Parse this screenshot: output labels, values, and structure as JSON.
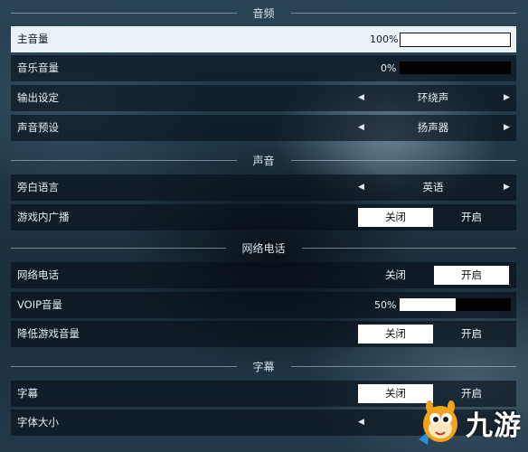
{
  "sections": {
    "audio": "音频",
    "voice": "声音",
    "voip": "网络电话",
    "subtitles": "字幕"
  },
  "rows": {
    "master_volume": {
      "label": "主音量",
      "percent_text": "100%",
      "value_percent": 100
    },
    "music_volume": {
      "label": "音乐音量",
      "percent_text": "0%",
      "value_percent": 0
    },
    "output": {
      "label": "输出设定",
      "value": "环绕声"
    },
    "sound_preset": {
      "label": "声音预设",
      "value": "扬声器"
    },
    "narration_language": {
      "label": "旁白语言",
      "value": "英语"
    },
    "ingame_broadcast": {
      "label": "游戏内广播",
      "off": "关闭",
      "on": "开启",
      "selected": "off"
    },
    "voip": {
      "label": "网络电话",
      "off": "关闭",
      "on": "开启",
      "selected": "on"
    },
    "voip_volume": {
      "label": "VOIP音量",
      "percent_text": "50%",
      "value_percent": 50
    },
    "lower_game_volume": {
      "label": "降低游戏音量",
      "off": "关闭",
      "on": "开启",
      "selected": "off"
    },
    "subtitles": {
      "label": "字幕",
      "off": "关闭",
      "on": "开启",
      "selected": "off"
    },
    "font_size": {
      "label": "字体大小"
    }
  },
  "icons": {
    "left_arrow": "◀",
    "right_arrow": "▶"
  },
  "watermark": {
    "text": "九游"
  }
}
